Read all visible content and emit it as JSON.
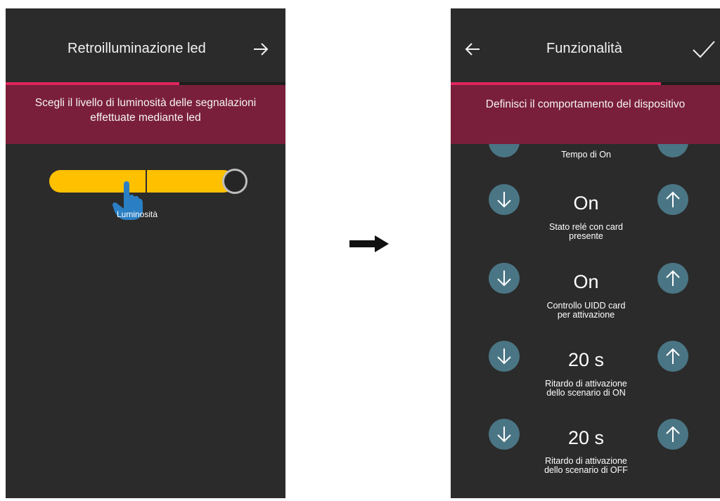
{
  "left_screen": {
    "header": {
      "title": "Retroilluminazione led",
      "next_icon": "arrow-right-icon"
    },
    "progress": 0.62,
    "banner": {
      "line1": "Scegli il livello di luminosità delle segnalazioni",
      "line2": "effettuate mediante led"
    },
    "slider": {
      "label": "Luminosità",
      "level": 0.92
    }
  },
  "transition_arrow_icon": "arrow-right-icon",
  "right_screen": {
    "header": {
      "title": "Funzionalità",
      "back_icon": "arrow-left-icon",
      "confirm_icon": "check-icon"
    },
    "progress": 0.78,
    "banner": {
      "text": "Definisci il comportamento del dispositivo"
    },
    "partial_row_label": "Tempo di On",
    "rows": [
      {
        "value": "On",
        "label_line1": "Stato relé con card",
        "label_line2": "presente"
      },
      {
        "value": "On",
        "label_line1": "Controllo UIDD card",
        "label_line2": "per attivazione"
      },
      {
        "value": "20 s",
        "label_line1": "Ritardo di attivazione",
        "label_line2": "dello scenario di ON"
      },
      {
        "value": "20 s",
        "label_line1": "Ritardo di attivazione",
        "label_line2": "dello scenario di OFF"
      }
    ]
  },
  "colors": {
    "screen_bg": "#2b2b2b",
    "accent": "#e0245e",
    "banner": "#7a1f3b",
    "slider": "#ffc000",
    "round_button": "#4a7584"
  }
}
